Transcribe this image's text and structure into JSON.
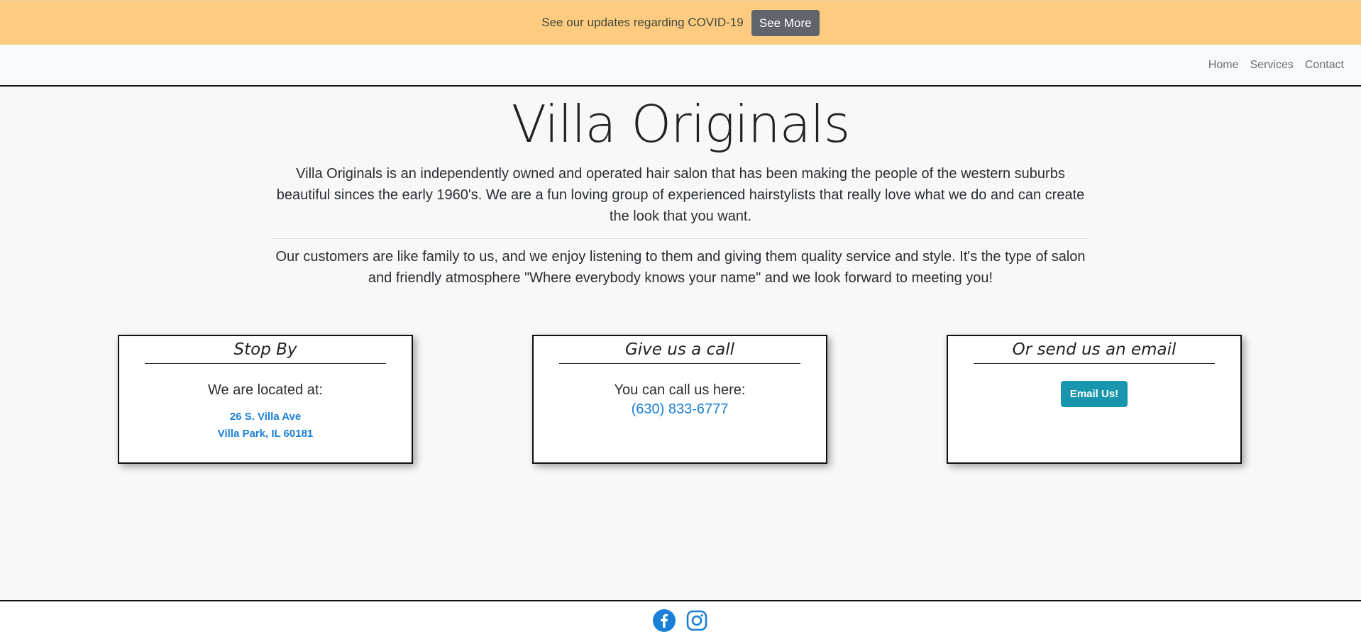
{
  "banner": {
    "text": "See our updates regarding COVID-19",
    "button_label": "See More",
    "background": "#ffcb80"
  },
  "nav": {
    "items": [
      {
        "label": "Home"
      },
      {
        "label": "Services"
      },
      {
        "label": "Contact"
      }
    ]
  },
  "hero": {
    "title": "Villa Originals",
    "paragraph_1": "Villa Originals is an independently owned and operated hair salon that has been making the people of the western suburbs beautiful sinces the early 1960's. We are a fun loving group of experienced hairstylists that really love what we do and can create the look that you want.",
    "paragraph_2": "Our customers are like family to us, and we enjoy listening to them and giving them quality service and style. It's the type of salon and friendly atmosphere \"Where everybody knows your name\" and we look forward to meeting you!"
  },
  "cards": {
    "visit": {
      "title": "Stop By",
      "text": "We are located at:",
      "address_line_1": "26 S. Villa Ave",
      "address_line_2": "Villa Park, IL 60181"
    },
    "call": {
      "title": "Give us a call",
      "text": "You can call us here:",
      "phone": "(630) 833-6777"
    },
    "email": {
      "title": "Or send us an email",
      "button_label": "Email Us!"
    }
  },
  "footer": {
    "icons": [
      "facebook-icon",
      "instagram-icon"
    ]
  },
  "colors": {
    "link": "#1a7fd6",
    "email_button": "#1896ae",
    "see_more_button": "#5f656b"
  }
}
